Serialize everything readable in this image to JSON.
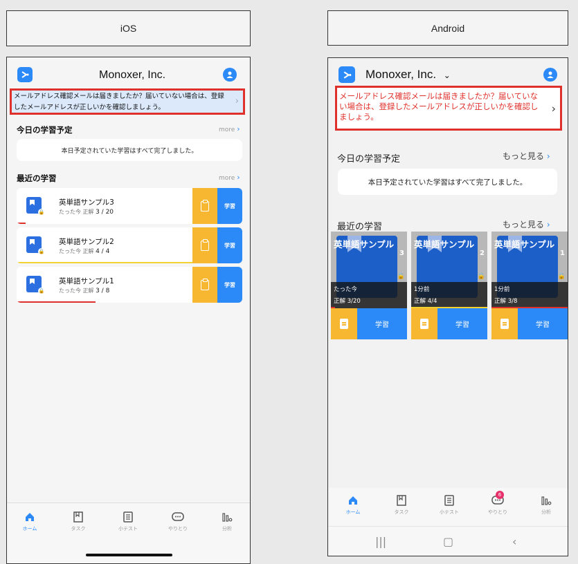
{
  "labels": {
    "ios": "iOS",
    "android": "Android"
  },
  "ios": {
    "title": "Monoxer, Inc.",
    "banner": "メールアドレス確認メールは届きましたか？届いていない場合は、登録したメールアドレスが正しいかを確認しましょう。",
    "today": {
      "title": "今日の学習予定",
      "more": "more",
      "done": "本日予定されていた学習はすべて完了しました。"
    },
    "recent": {
      "title": "最近の学習",
      "more": "more",
      "items": [
        {
          "title": "英単語サンプル3",
          "time": "たった今",
          "correct_label": "正解",
          "score": "3 / 20",
          "study": "学習",
          "progress": 0.05,
          "progress_color": "#e0302b"
        },
        {
          "title": "英単語サンプル2",
          "time": "たった今",
          "correct_label": "正解",
          "score": "4 / 4",
          "study": "学習",
          "progress": 1.0,
          "progress_color": "#f2d22e"
        },
        {
          "title": "英単語サンプル1",
          "time": "たった今",
          "correct_label": "正解",
          "score": "3 / 8",
          "study": "学習",
          "progress": 0.45,
          "progress_color": "#e0302b"
        }
      ]
    },
    "tabs": [
      {
        "label": "ホーム",
        "icon": "home-icon",
        "active": true
      },
      {
        "label": "タスク",
        "icon": "task-icon"
      },
      {
        "label": "小テスト",
        "icon": "quiz-icon"
      },
      {
        "label": "やりとり",
        "icon": "chat-icon"
      },
      {
        "label": "分析",
        "icon": "analytics-icon"
      }
    ]
  },
  "android": {
    "title": "Monoxer, Inc.",
    "banner": "メールアドレス確認メールは届きましたか？届いていない場合は、登録したメールアドレスが正しいかを確認しましょう。",
    "today": {
      "title": "今日の学習予定",
      "more": "もっと見る",
      "done": "本日予定されていた学習はすべて完了しました。"
    },
    "recent": {
      "title": "最近の学習",
      "more": "もっと見る",
      "cards": [
        {
          "title": "英単語サンプル",
          "num": "3",
          "time": "たった今",
          "score": "正解 3/20",
          "study": "学習",
          "progress": 0.05,
          "progress_color": "#e0302b"
        },
        {
          "title": "英単語サンプル",
          "num": "2",
          "time": "1分前",
          "score": "正解 4/4",
          "study": "学習",
          "progress": 1.0,
          "progress_color": "#f2d22e"
        },
        {
          "title": "英単語サンプル",
          "num": "1",
          "time": "1分前",
          "score": "正解 3/8",
          "study": "学習",
          "progress": 1.0,
          "progress_color": "#e0302b"
        }
      ]
    },
    "tabs": [
      {
        "label": "ホーム",
        "icon": "home-icon",
        "active": true
      },
      {
        "label": "タスク",
        "icon": "task-icon"
      },
      {
        "label": "小テスト",
        "icon": "quiz-icon"
      },
      {
        "label": "やりとり",
        "icon": "chat-icon",
        "badge": "6"
      },
      {
        "label": "分析",
        "icon": "analytics-icon"
      }
    ]
  }
}
